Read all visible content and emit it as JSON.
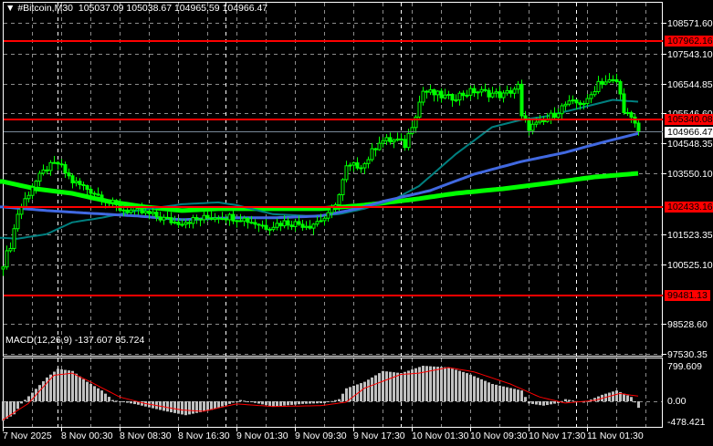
{
  "header": {
    "menu_icon": "triangle-down-icon",
    "symbol": "#Bitcoin,M30",
    "ohlc": "105037.09 105038.67 104965.59 104966.47"
  },
  "colors": {
    "background": "#000000",
    "grid": "#8c8c8c",
    "candle": "#00ff00",
    "level": "#ff0000",
    "ma_fast": "#008080",
    "ma_mid": "#4169e1",
    "ma_slow": "#00ff00",
    "macd_hist": "#c0c0c0",
    "macd_signal": "#ff0000"
  },
  "price_axis": {
    "min": 97530.35,
    "max": 108571.6,
    "ticks": [
      "108571.60",
      "107543.10",
      "106544.85",
      "105546.60",
      "104548.35",
      "103550.10",
      "101523.35",
      "100525.10",
      "98528.60",
      "97530.35"
    ]
  },
  "levels": [
    "107962.16",
    "105340.08",
    "102433.16",
    "99481.13"
  ],
  "bid": "104966.47",
  "time_axis": [
    {
      "label": "7 Nov 2025",
      "bar": 0
    },
    {
      "label": "8 Nov 00:30",
      "bar": 16
    },
    {
      "label": "8 Nov 08:30",
      "bar": 32
    },
    {
      "label": "8 Nov 16:30",
      "bar": 48
    },
    {
      "label": "9 Nov 01:30",
      "bar": 64
    },
    {
      "label": "9 Nov 09:30",
      "bar": 80
    },
    {
      "label": "9 Nov 17:30",
      "bar": 96
    },
    {
      "label": "10 Nov 01:30",
      "bar": 112
    },
    {
      "label": "10 Nov 09:30",
      "bar": 128
    },
    {
      "label": "10 Nov 17:30",
      "bar": 144
    },
    {
      "label": "11 Nov 01:30",
      "bar": 160
    }
  ],
  "day_separators": [
    15,
    61,
    109,
    157
  ],
  "chart_data": {
    "type": "candlestick",
    "bars": 175,
    "close_keypoints": [
      [
        0,
        100560
      ],
      [
        2,
        101160
      ],
      [
        4,
        102220
      ],
      [
        8,
        103130
      ],
      [
        12,
        103730
      ],
      [
        15,
        103880
      ],
      [
        19,
        103280
      ],
      [
        24,
        102980
      ],
      [
        32,
        102370
      ],
      [
        39,
        102220
      ],
      [
        47,
        101920
      ],
      [
        53,
        102010
      ],
      [
        59,
        102130
      ],
      [
        65,
        102070
      ],
      [
        72,
        101770
      ],
      [
        77,
        101920
      ],
      [
        84,
        101830
      ],
      [
        89,
        102130
      ],
      [
        92,
        102830
      ],
      [
        94,
        103730
      ],
      [
        99,
        103880
      ],
      [
        103,
        104640
      ],
      [
        108,
        104640
      ],
      [
        110,
        104490
      ],
      [
        113,
        105550
      ],
      [
        115,
        106300
      ],
      [
        122,
        106060
      ],
      [
        129,
        106300
      ],
      [
        137,
        106150
      ],
      [
        141,
        106450
      ],
      [
        142,
        105400
      ],
      [
        144,
        105090
      ],
      [
        148,
        105250
      ],
      [
        154,
        105850
      ],
      [
        160,
        105940
      ],
      [
        163,
        106610
      ],
      [
        168,
        106610
      ],
      [
        170,
        105700
      ],
      [
        174,
        104966
      ]
    ],
    "ma_fast": [
      [
        0,
        101402
      ],
      [
        4,
        101372
      ],
      [
        12,
        101523
      ],
      [
        19,
        101917
      ],
      [
        27,
        102068
      ],
      [
        37,
        102310
      ],
      [
        49,
        102522
      ],
      [
        59,
        102583
      ],
      [
        64,
        102492
      ],
      [
        74,
        102189
      ],
      [
        84,
        102129
      ],
      [
        92,
        102189
      ],
      [
        99,
        102370
      ],
      [
        107,
        102673
      ],
      [
        114,
        103127
      ],
      [
        124,
        104186
      ],
      [
        134,
        105093
      ],
      [
        142,
        105335
      ],
      [
        149,
        105456
      ],
      [
        159,
        105759
      ],
      [
        167,
        106001
      ],
      [
        174,
        105940
      ]
    ],
    "ma_mid": [
      [
        0,
        102431
      ],
      [
        12,
        102310
      ],
      [
        24,
        102219
      ],
      [
        37,
        102128
      ],
      [
        49,
        102007
      ],
      [
        62,
        102068
      ],
      [
        74,
        102068
      ],
      [
        87,
        102128
      ],
      [
        97,
        102370
      ],
      [
        104,
        102612
      ],
      [
        117,
        102975
      ],
      [
        129,
        103520
      ],
      [
        142,
        103943
      ],
      [
        154,
        104246
      ],
      [
        164,
        104579
      ],
      [
        174,
        104881
      ]
    ],
    "ma_slow": [
      [
        0,
        103278
      ],
      [
        9,
        103036
      ],
      [
        19,
        102884
      ],
      [
        29,
        102612
      ],
      [
        39,
        102431
      ],
      [
        49,
        102310
      ],
      [
        59,
        102370
      ],
      [
        74,
        102370
      ],
      [
        87,
        102370
      ],
      [
        99,
        102491
      ],
      [
        112,
        102673
      ],
      [
        124,
        102884
      ],
      [
        137,
        103036
      ],
      [
        149,
        103218
      ],
      [
        162,
        103430
      ],
      [
        174,
        103550
      ]
    ],
    "macd": {
      "title": "MACD(12,26,9) -137.607 85.724",
      "axis_labels": [
        "799.609",
        "0.00",
        "-478.421"
      ],
      "min": -478.421,
      "max": 799.609,
      "hist_keypoints": [
        [
          0,
          -450
        ],
        [
          3,
          -300
        ],
        [
          5,
          -50
        ],
        [
          8,
          200
        ],
        [
          12,
          550
        ],
        [
          15,
          750
        ],
        [
          19,
          700
        ],
        [
          23,
          450
        ],
        [
          27,
          250
        ],
        [
          30,
          30
        ],
        [
          37,
          -80
        ],
        [
          44,
          -220
        ],
        [
          50,
          -320
        ],
        [
          57,
          -200
        ],
        [
          62,
          -60
        ],
        [
          65,
          30
        ],
        [
          68,
          -20
        ],
        [
          74,
          -120
        ],
        [
          82,
          -60
        ],
        [
          88,
          -40
        ],
        [
          92,
          50
        ],
        [
          94,
          300
        ],
        [
          99,
          450
        ],
        [
          104,
          700
        ],
        [
          109,
          650
        ],
        [
          115,
          820
        ],
        [
          122,
          780
        ],
        [
          127,
          650
        ],
        [
          134,
          400
        ],
        [
          142,
          250
        ],
        [
          144,
          -50
        ],
        [
          148,
          -100
        ],
        [
          152,
          -40
        ],
        [
          154,
          50
        ],
        [
          159,
          -30
        ],
        [
          164,
          150
        ],
        [
          168,
          250
        ],
        [
          172,
          100
        ],
        [
          174,
          -150
        ]
      ],
      "signal_keypoints": [
        [
          0,
          -430
        ],
        [
          7,
          -50
        ],
        [
          14,
          600
        ],
        [
          19,
          650
        ],
        [
          24,
          450
        ],
        [
          32,
          100
        ],
        [
          39,
          -50
        ],
        [
          49,
          -200
        ],
        [
          55,
          -230
        ],
        [
          64,
          -60
        ],
        [
          74,
          -120
        ],
        [
          87,
          -100
        ],
        [
          94,
          -20
        ],
        [
          99,
          300
        ],
        [
          109,
          620
        ],
        [
          114,
          650
        ],
        [
          122,
          780
        ],
        [
          129,
          680
        ],
        [
          139,
          400
        ],
        [
          147,
          100
        ],
        [
          154,
          -40
        ],
        [
          162,
          20
        ],
        [
          169,
          180
        ],
        [
          174,
          120
        ]
      ]
    }
  }
}
